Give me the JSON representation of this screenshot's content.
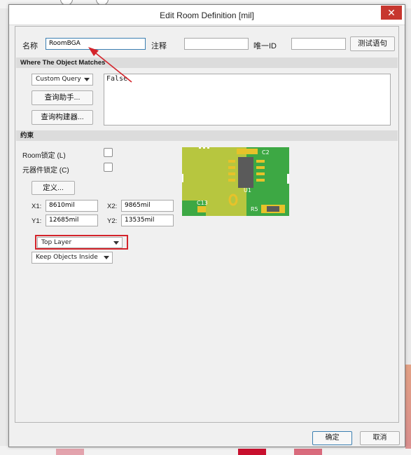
{
  "window": {
    "title": "Edit Room Definition [mil]",
    "close_glyph": "✕"
  },
  "header_row": {
    "name_label": "名称",
    "name_value": "RoomBGA",
    "comment_label": "注释",
    "comment_value": "",
    "uid_label": "唯一ID",
    "uid_value": "",
    "test_button": "测试语句"
  },
  "where_section": {
    "title": "Where The Object Matches",
    "query_type": "Custom Query",
    "query_helper_button": "查询助手...",
    "query_builder_button": "查询构建器...",
    "query_text": "False"
  },
  "constraints": {
    "title": "约束",
    "room_lock_label": "Room锁定 (L)",
    "room_lock_checked": false,
    "component_lock_label": "元器件锁定 (C)",
    "component_lock_checked": false,
    "define_button": "定义...",
    "x1_label": "X1:",
    "x1_value": "8610mil",
    "x2_label": "X2:",
    "x2_value": "9865mil",
    "y1_label": "Y1:",
    "y1_value": "12685mil",
    "y2_label": "Y2:",
    "y2_value": "13535mil",
    "layer": "Top Layer",
    "keep_mode": "Keep Objects Inside",
    "preview_labels": {
      "c2": "C2",
      "u1": "U1",
      "c13": "C13",
      "r5": "R5"
    }
  },
  "buttons": {
    "ok": "确定",
    "cancel": "取消"
  },
  "colors": {
    "annotation_arrow": "#d4242b",
    "highlight_box": "#d4242b",
    "pcb_board": "#b7c63f",
    "pcb_green": "#4caf50",
    "pad": "#e7c22a"
  }
}
